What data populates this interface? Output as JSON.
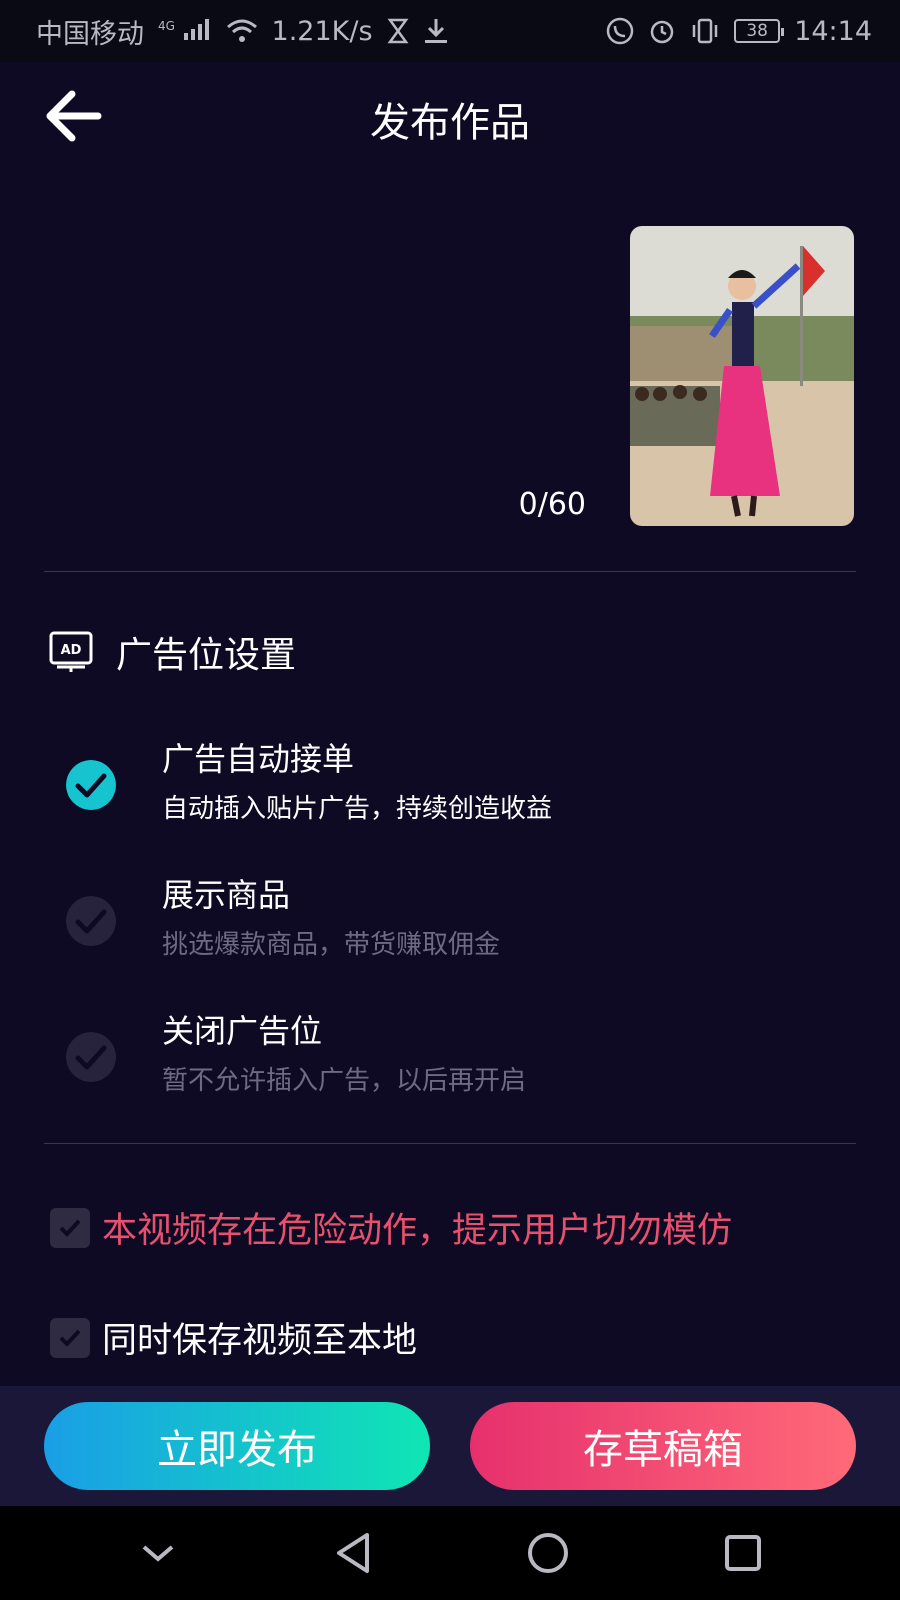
{
  "status_bar": {
    "carrier": "中国移动",
    "network": "4G",
    "speed": "1.21K/s",
    "battery": "38",
    "time": "14:14"
  },
  "header": {
    "title": "发布作品",
    "back_icon": "back-arrow-icon"
  },
  "description": {
    "char_count": "0/60"
  },
  "ad_settings": {
    "title": "广告位设置",
    "icon": "ad-icon",
    "ad_icon_text": "AD",
    "options": [
      {
        "title": "广告自动接单",
        "subtitle": "自动插入贴片广告，持续创造收益",
        "selected": true
      },
      {
        "title": "展示商品",
        "subtitle": "挑选爆款商品，带货赚取佣金",
        "selected": false
      },
      {
        "title": "关闭广告位",
        "subtitle": "暂不允许插入广告，以后再开启",
        "selected": false
      }
    ]
  },
  "checkboxes": {
    "danger_warning": "本视频存在危险动作，提示用户切勿模仿",
    "save_local": "同时保存视频至本地"
  },
  "colors": {
    "background": "#0f0a24",
    "warning_text": "#e8516e",
    "check_active": "#16c4cf",
    "publish_gradient": [
      "#1a9ee6",
      "#0fe6b4"
    ],
    "draft_gradient": [
      "#e6306e",
      "#ff6a78"
    ]
  },
  "buttons": {
    "publish": "立即发布",
    "draft": "存草稿箱"
  },
  "nav_bar": {
    "down_icon": "chevron-down-icon",
    "back_icon": "triangle-back-icon",
    "home_icon": "circle-home-icon",
    "recents_icon": "square-recents-icon"
  }
}
